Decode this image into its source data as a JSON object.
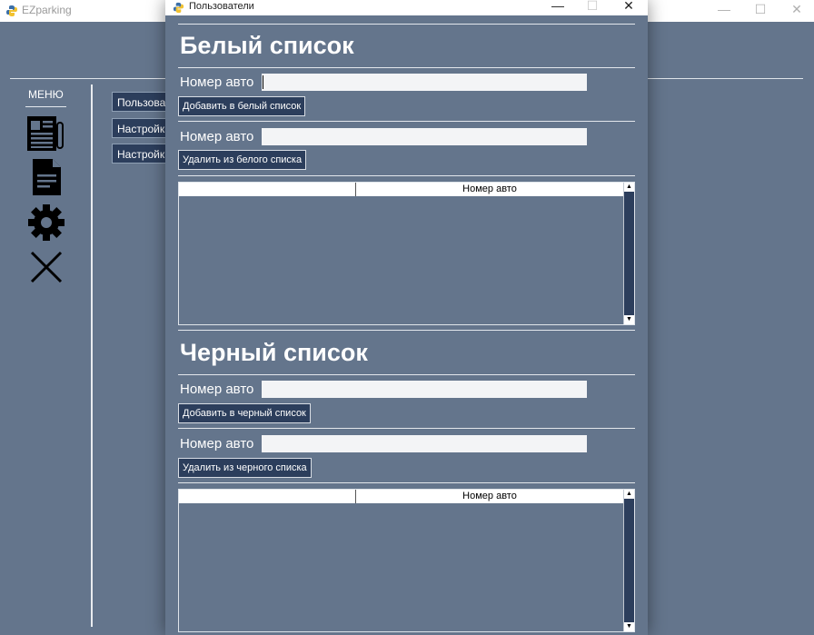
{
  "main_window": {
    "title": "EZparking",
    "controls": {
      "minimize": "—",
      "maximize": "☐",
      "close": "✕"
    },
    "menu_label": "МЕНЮ",
    "menu_icons": [
      "newspaper-icon",
      "document-icon",
      "gear-icon",
      "close-icon"
    ],
    "side_buttons": [
      "Пользователи",
      "Настройки",
      "Настройки"
    ]
  },
  "dialog": {
    "title": "Пользователи",
    "controls": {
      "minimize": "—",
      "maximize": "☐",
      "close": "✕"
    },
    "whitelist": {
      "title": "Белый список",
      "add_label": "Номер авто",
      "add_value": "",
      "add_button": "Добавить в белый список",
      "remove_label": "Номер авто",
      "remove_value": "",
      "remove_button": "Удалить из белого списка",
      "table_columns": [
        "",
        "Номер авто"
      ]
    },
    "blacklist": {
      "title": "Черный список",
      "add_label": "Номер авто",
      "add_value": "",
      "add_button": "Добавить в черный список",
      "remove_label": "Номер авто",
      "remove_value": "",
      "remove_button": "Удалить из черного списка",
      "table_columns": [
        "",
        "Номер авто"
      ]
    },
    "scroll_up": "▲",
    "scroll_down": "▼"
  },
  "colors": {
    "background": "#64758c",
    "button": "#2c3e5c",
    "text": "#ffffff"
  }
}
